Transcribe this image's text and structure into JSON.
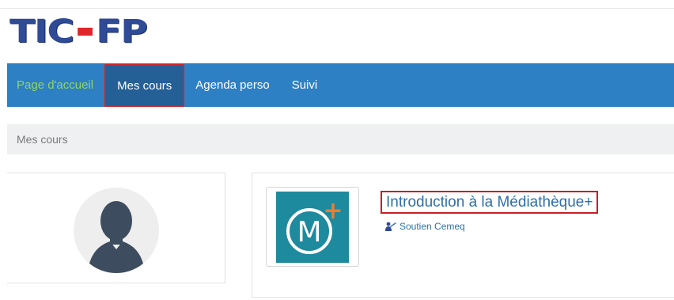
{
  "logo": {
    "part1": "TIC",
    "part2": "FP"
  },
  "nav": {
    "items": [
      {
        "label": "Page d'accueil"
      },
      {
        "label": "Mes cours"
      },
      {
        "label": "Agenda perso"
      },
      {
        "label": "Suivi"
      }
    ],
    "active_index": 1
  },
  "breadcrumb": {
    "label": "Mes cours"
  },
  "course": {
    "title": "Introduction à la Médiathèque+",
    "teacher": "Soutien Cemeq",
    "thumb_letter": "M",
    "thumb_plus": "+"
  },
  "colors": {
    "nav_bg": "#2d80c4",
    "nav_active_bg": "#245f96",
    "home_link": "#8fd46a",
    "highlight_border": "#d0232a",
    "logo_blue": "#2f4b96",
    "logo_red": "#e0262b",
    "thumb_bg": "#1e8a9e",
    "link": "#2f6fa8"
  },
  "icons": {
    "avatar": "user-silhouette-icon",
    "teacher": "teacher-icon"
  }
}
